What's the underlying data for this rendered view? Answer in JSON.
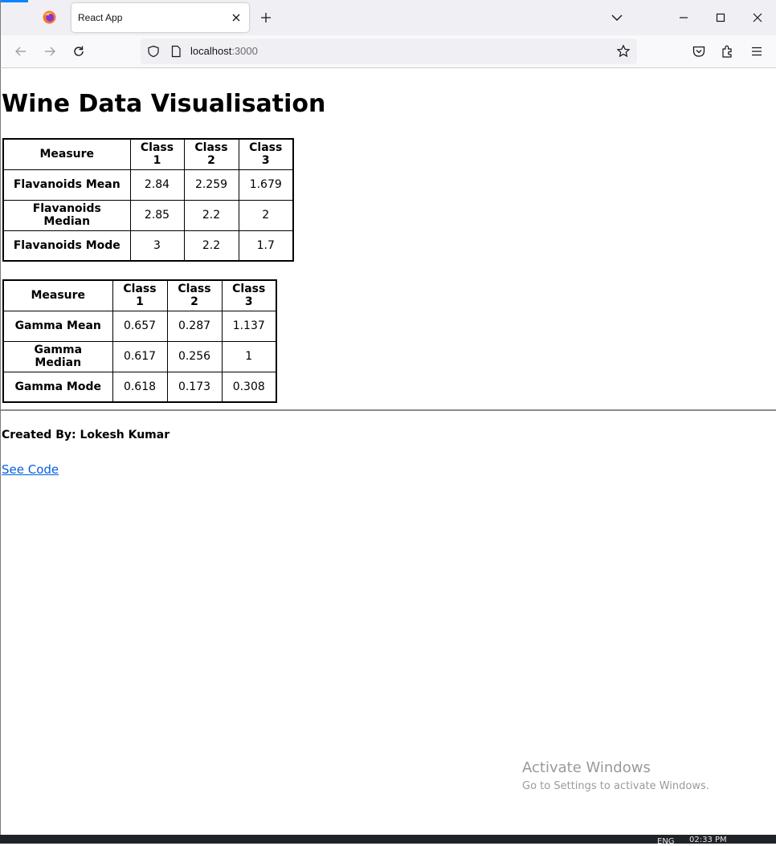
{
  "browser": {
    "tab_title": "React App",
    "url_host": "localhost",
    "url_port": ":3000"
  },
  "page": {
    "title": "Wine Data Visualisation",
    "flavanoids_table": {
      "headers": [
        "Measure",
        "Class 1",
        "Class 2",
        "Class 3"
      ],
      "rows": [
        {
          "measure": "Flavanoids Mean",
          "values": [
            "2.84",
            "2.259",
            "1.679"
          ]
        },
        {
          "measure": "Flavanoids Median",
          "values": [
            "2.85",
            "2.2",
            "2"
          ]
        },
        {
          "measure": "Flavanoids Mode",
          "values": [
            "3",
            "2.2",
            "1.7"
          ]
        }
      ]
    },
    "gamma_table": {
      "headers": [
        "Measure",
        "Class 1",
        "Class 2",
        "Class 3"
      ],
      "rows": [
        {
          "measure": "Gamma Mean",
          "values": [
            "0.657",
            "0.287",
            "1.137"
          ]
        },
        {
          "measure": "Gamma Median",
          "values": [
            "0.617",
            "0.256",
            "1"
          ]
        },
        {
          "measure": "Gamma Mode",
          "values": [
            "0.618",
            "0.173",
            "0.308"
          ]
        }
      ]
    },
    "footer": {
      "credit": "Created By: Lokesh Kumar",
      "link_label": "See Code"
    }
  },
  "os": {
    "watermark_title": "Activate Windows",
    "watermark_subtitle": "Go to Settings to activate Windows.",
    "tray_language": "ENG",
    "tray_time": "02:33 PM"
  },
  "colors": {
    "link": "#0060df",
    "accent": "#0a84ff",
    "watermark": "#9a9a9a"
  }
}
